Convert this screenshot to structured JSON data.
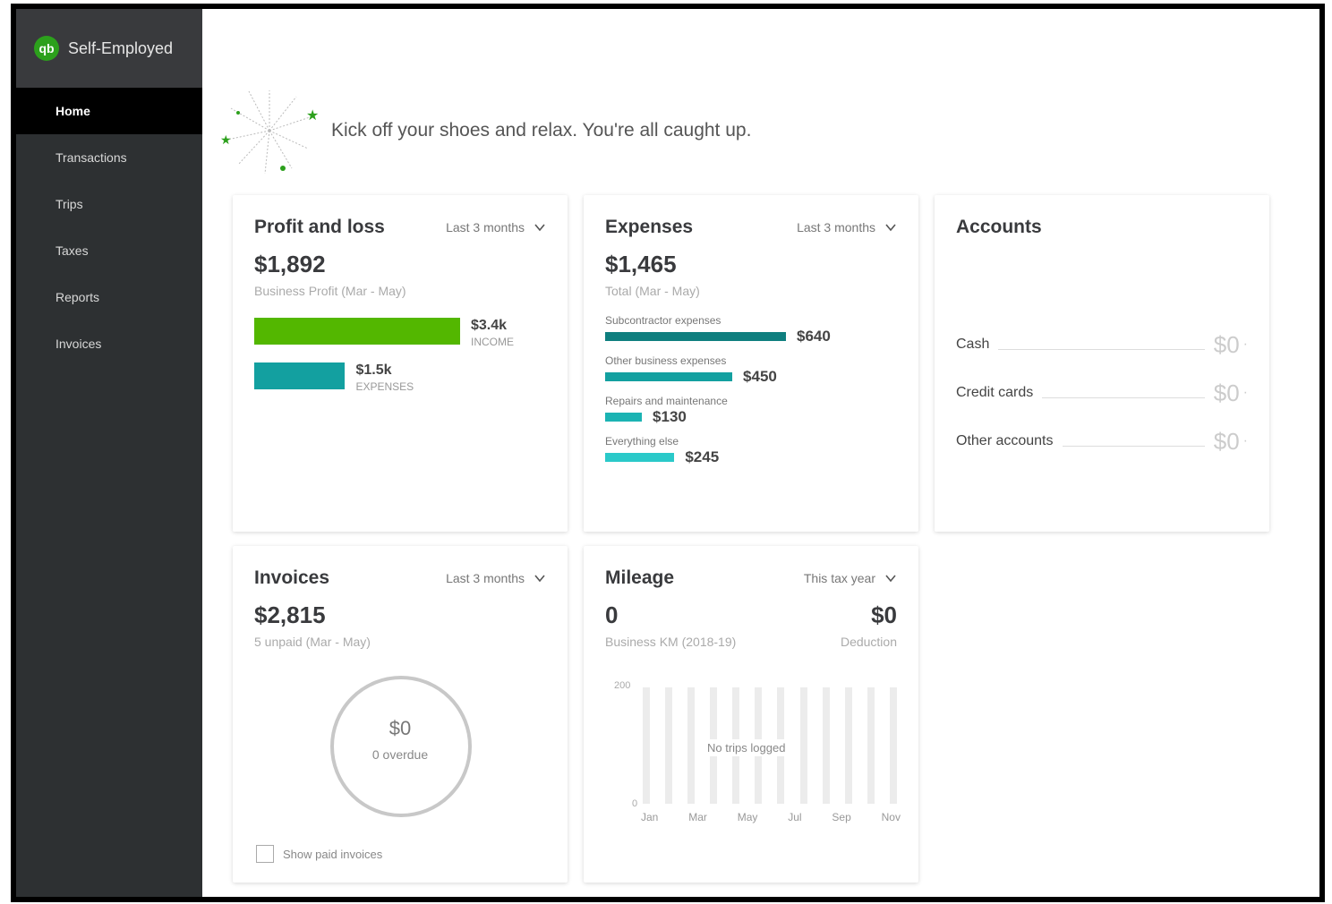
{
  "top_fragment": "UI",
  "brand": {
    "logo": "qb",
    "name": "Self-Employed"
  },
  "nav": [
    "Home",
    "Transactions",
    "Trips",
    "Taxes",
    "Reports",
    "Invoices"
  ],
  "hero": {
    "message": "Kick off your shoes and relax. You're all caught up."
  },
  "profit_loss": {
    "title": "Profit and loss",
    "period": "Last 3 months",
    "amount": "$1,892",
    "subtitle": "Business Profit (Mar - May)",
    "income": {
      "value": "$3.4k",
      "label": "INCOME",
      "amount": 3.4,
      "color": "#53b700"
    },
    "expenses": {
      "value": "$1.5k",
      "label": "EXPENSES",
      "amount": 1.5,
      "color": "#13a0a0"
    }
  },
  "expenses": {
    "title": "Expenses",
    "period": "Last 3 months",
    "amount": "$1,465",
    "subtitle": "Total (Mar - May)",
    "items": [
      {
        "name": "Subcontractor expenses",
        "value": "$640",
        "amount": 640,
        "color": "#0f7f7f"
      },
      {
        "name": "Other business expenses",
        "value": "$450",
        "amount": 450,
        "color": "#13a0a0"
      },
      {
        "name": "Repairs and maintenance",
        "value": "$130",
        "amount": 130,
        "color": "#1bb3b3"
      },
      {
        "name": "Everything else",
        "value": "$245",
        "amount": 245,
        "color": "#2ac9c9"
      }
    ]
  },
  "accounts": {
    "title": "Accounts",
    "items": [
      {
        "name": "Cash",
        "value": "$0"
      },
      {
        "name": "Credit cards",
        "value": "$0"
      },
      {
        "name": "Other accounts",
        "value": "$0"
      }
    ]
  },
  "invoices": {
    "title": "Invoices",
    "period": "Last 3 months",
    "amount": "$2,815",
    "subtitle": "5 unpaid (Mar - May)",
    "ring_value": "$0",
    "ring_caption": "0 overdue",
    "show_paid_label": "Show paid invoices"
  },
  "mileage": {
    "title": "Mileage",
    "period": "This tax year",
    "distance": "0",
    "distance_label": "Business KM (2018-19)",
    "deduction": "$0",
    "deduction_label": "Deduction",
    "axis_top": "200",
    "axis_bottom": "0",
    "empty_message": "No trips logged",
    "months": [
      "Jan",
      "Mar",
      "May",
      "Jul",
      "Sep",
      "Nov"
    ]
  }
}
